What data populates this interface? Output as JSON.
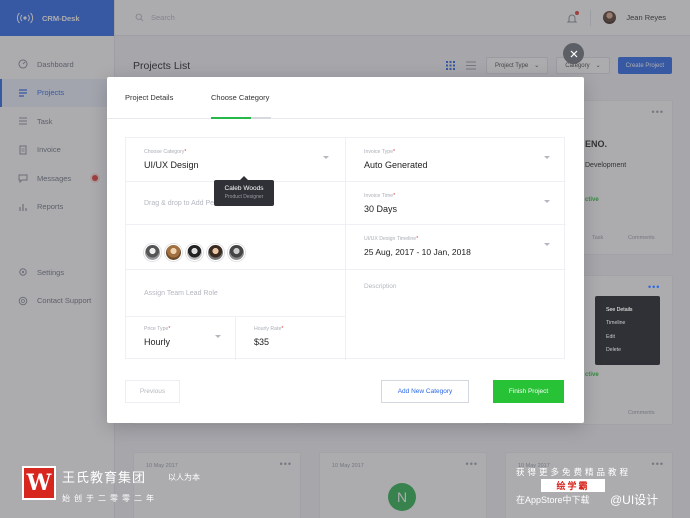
{
  "brand": {
    "name": "CRM-Desk"
  },
  "sidebar": {
    "items": [
      {
        "label": "Dashboard",
        "icon": "dashboard-icon"
      },
      {
        "label": "Projects",
        "icon": "projects-icon",
        "active": true
      },
      {
        "label": "Task",
        "icon": "task-icon"
      },
      {
        "label": "Invoice",
        "icon": "invoice-icon"
      },
      {
        "label": "Messages",
        "icon": "messages-icon",
        "notification": true
      },
      {
        "label": "Reports",
        "icon": "reports-icon"
      }
    ],
    "bottom_items": [
      {
        "label": "Settings",
        "icon": "gear-icon"
      },
      {
        "label": "Contact Support",
        "icon": "support-icon"
      }
    ]
  },
  "topbar": {
    "search_placeholder": "Search",
    "user_name": "Jean Reyes"
  },
  "main": {
    "title": "Projects List",
    "project_type_label": "Project Type",
    "category_label": "Category",
    "create_label": "Create Project"
  },
  "cards": {
    "date1": "10 May 2017",
    "date2": "10 May 2017",
    "date3": "10 May 2017"
  },
  "context_menu": {
    "items": [
      "See Details",
      "Timeline",
      "Edit",
      "Delete"
    ]
  },
  "modal": {
    "tabs": [
      "Project Details",
      "Choose Category"
    ],
    "active_tab": "Choose Category",
    "fields": {
      "category": {
        "label": "Choose Category",
        "value": "UI/UX Design"
      },
      "invoice_type": {
        "label": "Invoice Type",
        "value": "Auto Generated"
      },
      "people_placeholder": "Drag & drop to Add Peoples Or Search",
      "invoice_time": {
        "label": "Invoice Time",
        "value": "30 Days"
      },
      "timeline": {
        "label": "UI/UX Design Timeline",
        "value": "25 Aug, 2017 - 10 Jan, 2018"
      },
      "team_lead_placeholder": "Assign Team Lead Role",
      "description_placeholder": "Description",
      "price_type": {
        "label": "Price Type",
        "value": "Hourly"
      },
      "hourly_rate": {
        "label": "Hourly Rate",
        "value": "$35"
      }
    },
    "tooltip": {
      "name": "Caleb Woods",
      "role": "Product Designer"
    },
    "buttons": {
      "previous": "Previous",
      "add_category": "Add New Category",
      "finish": "Finish Project"
    }
  },
  "watermark": {
    "title": "王氏教育集团",
    "motto": "以人为本",
    "sub": "始创于二零零二年",
    "right_line1": "获得更多免费精品教程",
    "right_badge": "绘学霸",
    "right_line3": "在AppStore中下载",
    "weibo": "@UI设计"
  },
  "colors": {
    "accent": "#2a67e8",
    "success": "#27c236",
    "danger": "#e53935"
  }
}
